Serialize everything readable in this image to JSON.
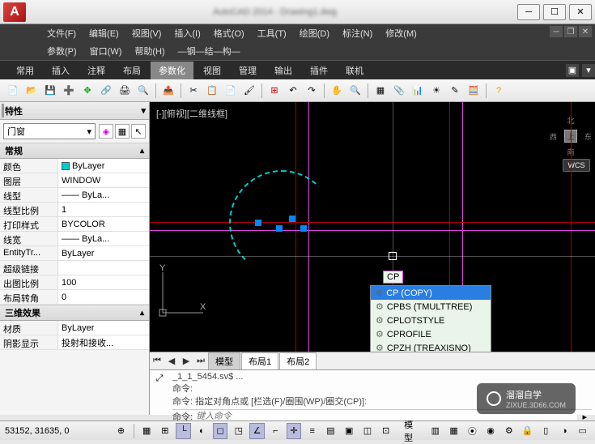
{
  "title": "AutoCAD 2014 - Drawing1.dwg",
  "menu1": [
    "文件(F)",
    "编辑(E)",
    "视图(V)",
    "插入(I)",
    "格式(O)",
    "工具(T)",
    "绘图(D)",
    "标注(N)",
    "修改(M)"
  ],
  "menu2": [
    "参数(P)",
    "窗口(W)",
    "帮助(H)",
    "—钢—结—构—"
  ],
  "tabs": {
    "items": [
      "常用",
      "插入",
      "注释",
      "布局",
      "参数化",
      "视图",
      "管理",
      "输出",
      "插件",
      "联机"
    ],
    "active": 4
  },
  "properties": {
    "title": "特性",
    "selector": "门窗",
    "cat1": {
      "title": "常规",
      "rows": [
        {
          "label": "颜色",
          "value": "ByLayer",
          "color": true
        },
        {
          "label": "图层",
          "value": "WINDOW"
        },
        {
          "label": "线型",
          "value": "—— ByLa..."
        },
        {
          "label": "线型比例",
          "value": "1"
        },
        {
          "label": "打印样式",
          "value": "BYCOLOR"
        },
        {
          "label": "线宽",
          "value": "—— ByLa..."
        },
        {
          "label": "EntityTr...",
          "value": "ByLayer"
        },
        {
          "label": "超级链接",
          "value": ""
        },
        {
          "label": "出图比例",
          "value": "100"
        },
        {
          "label": "布局转角",
          "value": "0"
        }
      ]
    },
    "cat2": {
      "title": "三维效果",
      "rows": [
        {
          "label": "材质",
          "value": "ByLayer"
        },
        {
          "label": "阴影显示",
          "value": "投射和接收..."
        }
      ]
    }
  },
  "viewport": {
    "label": "[-][俯视][二维线框]",
    "wcs": "WCS",
    "compass": {
      "n": "北",
      "s": "南",
      "e": "东",
      "w": "西",
      "c": "上"
    }
  },
  "model_tabs": [
    "模型",
    "布局1",
    "布局2"
  ],
  "command": {
    "history1": "_1_1_5454.sv$ ...",
    "history2": "命令:",
    "history3": "命令: 指定对角点或 [栏选(F)/圈围(WP)/圈交(CP)]:",
    "prompt": "命令:",
    "placeholder": "键入命令"
  },
  "dyn_input": "CP",
  "autocomplete": [
    {
      "label": "CP (COPY)",
      "sel": true,
      "icon": "⊕"
    },
    {
      "label": "CPBS (TMULTTREE)",
      "icon": "⚙"
    },
    {
      "label": "CPLOTSTYLE",
      "icon": "⚙"
    },
    {
      "label": "CPROFILE",
      "icon": "⚙"
    },
    {
      "label": "CPZH (TREAXISNO)",
      "icon": "⚙"
    }
  ],
  "status": {
    "coords": "53152, 31635, 0",
    "model_label": "模型"
  },
  "watermark": {
    "text": "溜溜自学",
    "url": "ZIXUE.3D66.COM"
  }
}
